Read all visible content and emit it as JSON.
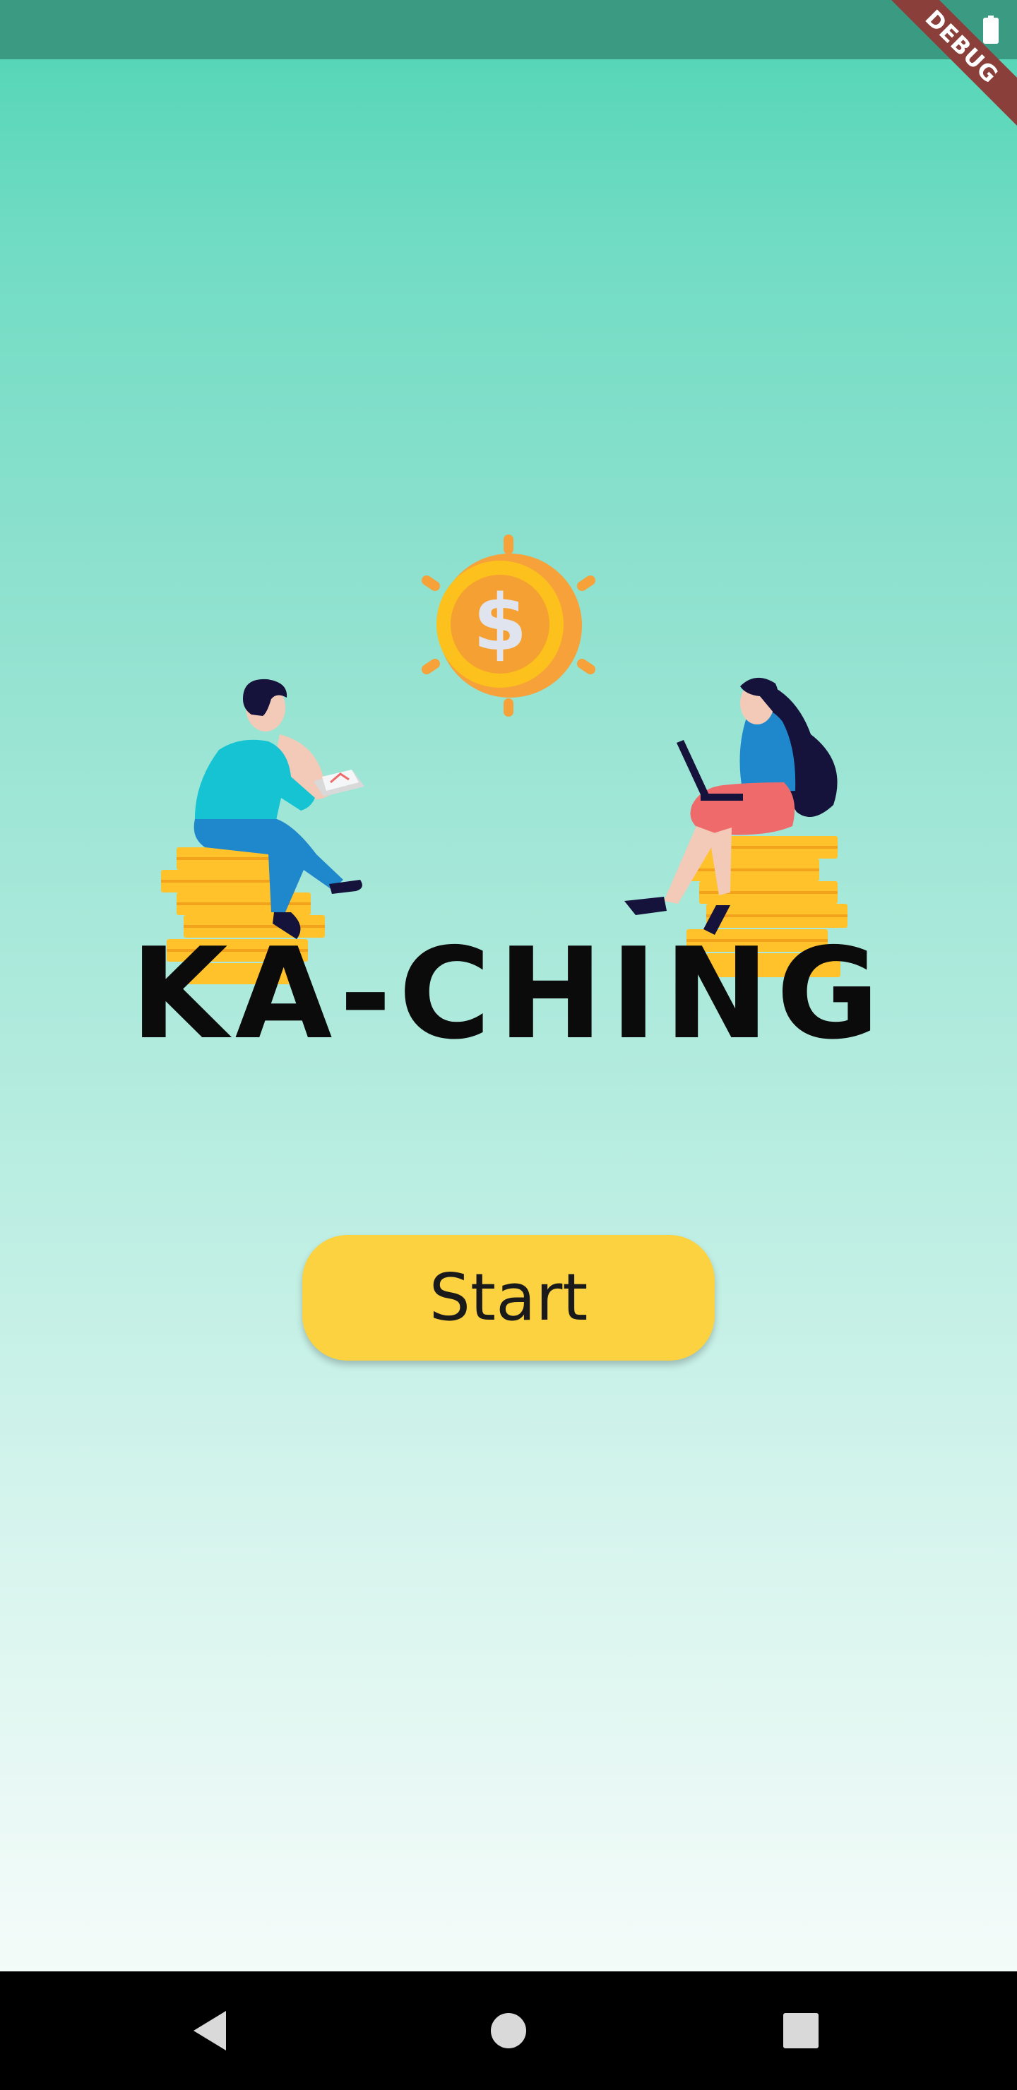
{
  "app": {
    "title": "KA-CHING"
  },
  "banner": {
    "label": "DEBUG"
  },
  "start_button": {
    "label": "Start"
  },
  "icons": {
    "status": "battery-icon",
    "nav_back": "back-triangle-icon",
    "nav_home": "home-circle-icon",
    "nav_recents": "recents-square-icon"
  },
  "colors": {
    "gradient_top": "#4fd4b4",
    "gradient_bottom": "#f5fcfa",
    "status_bar": "#3a9a82",
    "start_button": "#fdd240",
    "title_text": "#0b0b0b",
    "debug_banner": "#8a3f3a",
    "coin_gold": "#f6a13a",
    "coin_stack": "#ffc22b"
  }
}
